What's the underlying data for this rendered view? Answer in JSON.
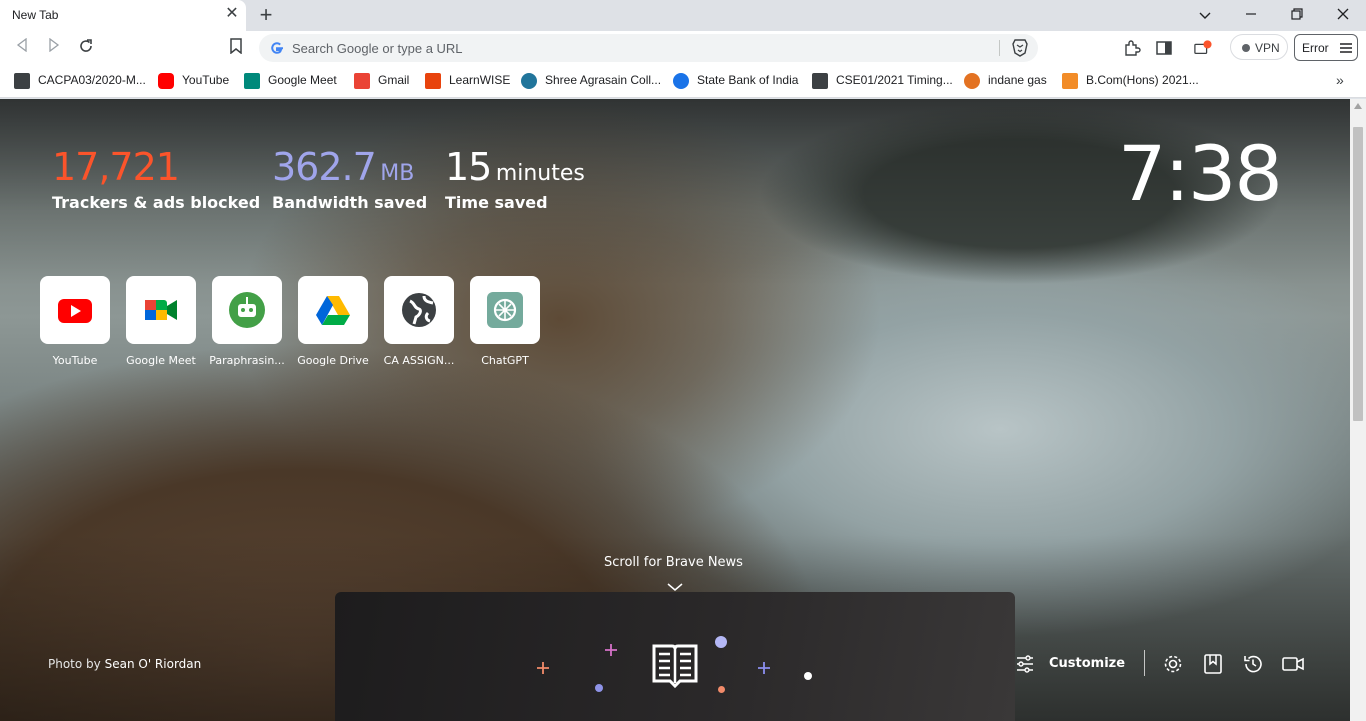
{
  "tab": {
    "title": "New Tab",
    "close_icon": "close-icon",
    "new_tab_icon": "plus-icon"
  },
  "window": {
    "minimize": "minimize-icon",
    "restore": "restore-icon",
    "close": "close-icon",
    "tab_search": "chevron-down-icon"
  },
  "toolbar": {
    "omnibox_placeholder": "Search Google or type a URL",
    "vpn_label": "VPN",
    "error_label": "Error"
  },
  "bookmarks": [
    {
      "label": "CACPA03/2020-M...",
      "color": "#3c4043"
    },
    {
      "label": "YouTube",
      "color": "#ff0000"
    },
    {
      "label": "Google Meet",
      "color": "#00897b"
    },
    {
      "label": "Gmail",
      "color": "#ea4335"
    },
    {
      "label": "LearnWISE",
      "color": "#e8430d"
    },
    {
      "label": "Shree Agrasain Coll...",
      "color": "#21759b"
    },
    {
      "label": "State Bank of India",
      "color": "#1a73e8"
    },
    {
      "label": "CSE01/2021 Timing...",
      "color": "#3c4043"
    },
    {
      "label": "indane gas",
      "color": "#e37222"
    },
    {
      "label": "B.Com(Hons) 2021...",
      "color": "#f28c28"
    }
  ],
  "stats": {
    "trackers": {
      "value": "17,721",
      "label": "Trackers & ads blocked",
      "color": "#fb542b"
    },
    "bandwidth": {
      "value": "362.7",
      "unit": "MB",
      "label": "Bandwidth saved",
      "color": "#a0a5eb"
    },
    "time": {
      "value": "15",
      "unit": "minutes",
      "label": "Time saved",
      "color": "#ffffff"
    }
  },
  "clock": "7:38",
  "top_sites": [
    {
      "label": "YouTube",
      "icon": "youtube-icon"
    },
    {
      "label": "Google Meet",
      "icon": "google-meet-icon"
    },
    {
      "label": "Paraphrasin...",
      "icon": "paraphrasing-tool-icon"
    },
    {
      "label": "Google Drive",
      "icon": "google-drive-icon"
    },
    {
      "label": "CA ASSIGN...",
      "icon": "globe-icon"
    },
    {
      "label": "ChatGPT",
      "icon": "chatgpt-icon"
    }
  ],
  "scroll_news": "Scroll for Brave News",
  "photo_credit": {
    "prefix": "Photo by",
    "author": "Sean O' Riordan"
  },
  "customize_label": "Customize",
  "bottom_icons": [
    "settings-icon",
    "bookmarks-icon",
    "history-icon",
    "video-call-icon"
  ]
}
